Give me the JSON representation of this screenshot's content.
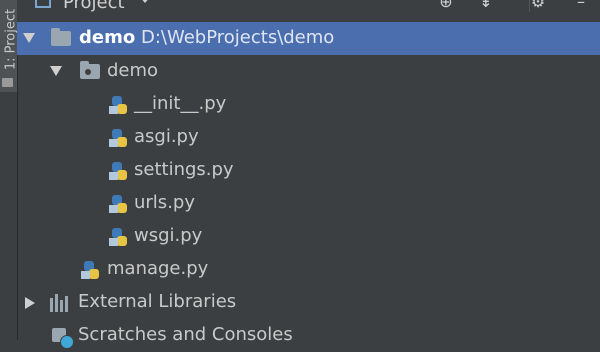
{
  "sidebar": {
    "tab_label": "1: Project"
  },
  "header": {
    "title": "Project",
    "icons": [
      "locate-icon",
      "collapse-icon",
      "settings-icon",
      "hide-icon"
    ]
  },
  "tree": {
    "root": {
      "name": "demo",
      "path": "D:\\WebProjects\\demo"
    },
    "package": {
      "name": "demo"
    },
    "files": [
      "__init__.py",
      "asgi.py",
      "settings.py",
      "urls.py",
      "wsgi.py"
    ],
    "manage": "manage.py",
    "external": "External Libraries",
    "scratches": "Scratches and Consoles"
  },
  "colors": {
    "selection": "#4b6eaf",
    "background": "#3c3f41",
    "python_blue": "#3f7ab8",
    "python_yellow": "#e8c444"
  }
}
